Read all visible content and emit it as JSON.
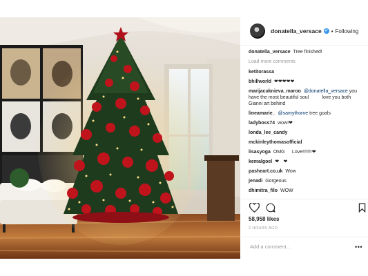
{
  "header": {
    "username": "donatella_versace",
    "verified_mark": "✔",
    "separator": "•",
    "follow_label": "Following"
  },
  "caption": {
    "username": "donatella_versace",
    "text": "Tree finished! ᅟᅟ"
  },
  "load_more_label": "Load more comments",
  "comments": [
    {
      "user": "ketitorassa",
      "text": "ᅟ"
    },
    {
      "user": "bhillworld",
      "text": "❤❤❤❤❤"
    },
    {
      "user": "marijacuknieva_maroo",
      "mention": "@donatella_versace",
      "text": "you have the most beautiful soulᅟᅟᅟlove you both ᅟGianni art behind ᅟᅟ"
    },
    {
      "user": "lineamarie_",
      "mention": "@samythorne",
      "text": "tree goals"
    },
    {
      "user": "ladyboss74",
      "text": "wow!❤ᅟ"
    },
    {
      "user": "londa_lee_candy",
      "text": "ᅟᅟᅟ"
    },
    {
      "user": "mckinleythomasofficial",
      "text": "ᅟᅟ"
    },
    {
      "user": "lisasyoga",
      "text": "OMG ᅟ Love!!!!!!!❤"
    },
    {
      "user": "kemalgoel",
      "text": "❤ᅟ❤"
    },
    {
      "user": "pasheart.co.uk",
      "text": "Wow ᅟ"
    },
    {
      "user": "jenadi",
      "text": "Gorgeous ᅟ"
    },
    {
      "user": "dhimitra_filo",
      "text": "WOWᅟᅟᅟᅟ"
    }
  ],
  "icons": {
    "like": "heart-icon",
    "comment": "comment-icon",
    "save": "bookmark-icon",
    "more": "more-options-icon"
  },
  "likes_text": "58,958 likes",
  "timestamp": "2 HOURS AGO",
  "add_comment_placeholder": "Add a comment…",
  "more_options_label": "•••"
}
